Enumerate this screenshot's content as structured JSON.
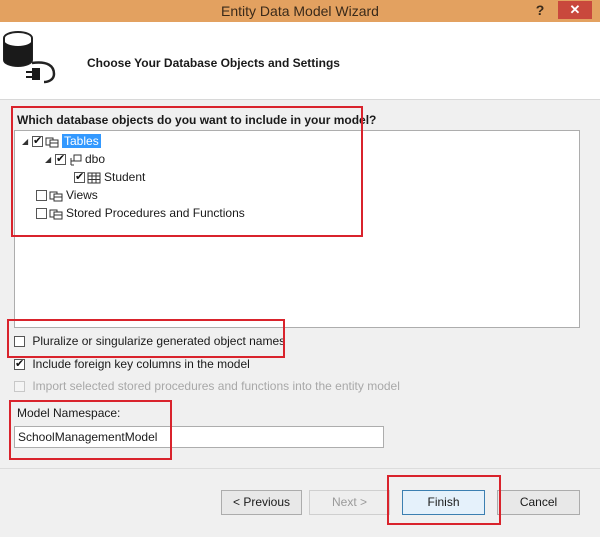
{
  "window": {
    "title": "Entity Data Model Wizard",
    "help_glyph": "?",
    "close_glyph": "✕"
  },
  "header": {
    "title": "Choose Your Database Objects and Settings"
  },
  "tree": {
    "question": "Which database objects do you want to include in your model?",
    "tables": {
      "label": "Tables",
      "checked": true,
      "expanded": true
    },
    "dbo": {
      "label": "dbo",
      "checked": true,
      "expanded": true
    },
    "student": {
      "label": "Student",
      "checked": true
    },
    "views": {
      "label": "Views",
      "checked": false
    },
    "procs": {
      "label": "Stored Procedures and Functions",
      "checked": false
    }
  },
  "options": {
    "pluralize": {
      "label": "Pluralize or singularize generated object names",
      "checked": false
    },
    "foreign_keys": {
      "label": "Include foreign key columns in the model",
      "checked": true
    },
    "import_procs": {
      "label": "Import selected stored procedures and functions into the entity model",
      "checked": false,
      "enabled": false
    }
  },
  "namespace": {
    "label": "Model Namespace:",
    "value": "SchoolManagementModel"
  },
  "buttons": {
    "previous": "< Previous",
    "next": "Next >",
    "finish": "Finish",
    "cancel": "Cancel"
  },
  "colors": {
    "titlebar": "#e3a160",
    "highlight_box": "#d9232c",
    "selection": "#3399ff",
    "close_button": "#c9483c"
  }
}
